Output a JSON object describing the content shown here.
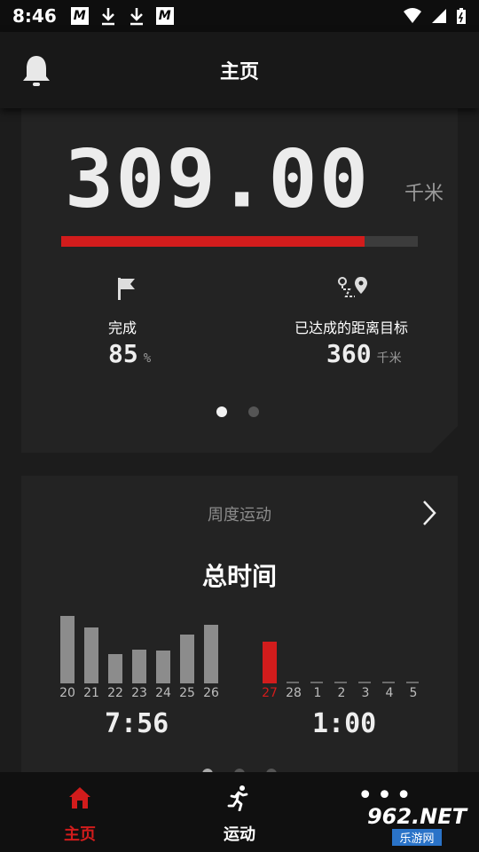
{
  "status_bar": {
    "time": "8:46",
    "m_letter": "M"
  },
  "app_bar": {
    "title": "主页"
  },
  "summary_card": {
    "total_distance": "309.00",
    "distance_unit": "千米",
    "progress_percent": 85,
    "completion": {
      "label": "完成",
      "value": "85",
      "unit": "%"
    },
    "goal": {
      "label": "已达成的距离目标",
      "value": "360",
      "unit": "千米"
    },
    "pages": 2,
    "active_page": 0
  },
  "weekly_card": {
    "header": "周度运动",
    "title": "总时间",
    "week1": {
      "days": [
        "20",
        "21",
        "22",
        "23",
        "24",
        "25",
        "26"
      ],
      "total": "7:56"
    },
    "week2": {
      "days": [
        "27",
        "28",
        "1",
        "2",
        "3",
        "4",
        "5"
      ],
      "total": "1:00",
      "today_index": 0
    }
  },
  "chart_data": {
    "type": "bar",
    "categories": [
      "20",
      "21",
      "22",
      "23",
      "24",
      "25",
      "26",
      "27",
      "28",
      "1",
      "2",
      "3",
      "4",
      "5"
    ],
    "values": [
      75,
      62,
      33,
      38,
      37,
      54,
      65,
      46,
      0,
      0,
      0,
      0,
      0,
      0
    ],
    "highlight_index": 7,
    "colors": {
      "default": "#8c8c8c",
      "highlight": "#d21c1c",
      "empty": "#6b6b6b"
    }
  },
  "bottom_nav": {
    "items": [
      {
        "label": "主页",
        "icon": "home-icon",
        "active": true
      },
      {
        "label": "运动",
        "icon": "run-icon",
        "active": false
      }
    ],
    "more_glyph": "•••"
  },
  "watermark": {
    "top": "962.NET",
    "bottom": "乐游网"
  },
  "colors": {
    "accent": "#d21c1c",
    "background": "#1c1c1c",
    "card": "#232323"
  }
}
